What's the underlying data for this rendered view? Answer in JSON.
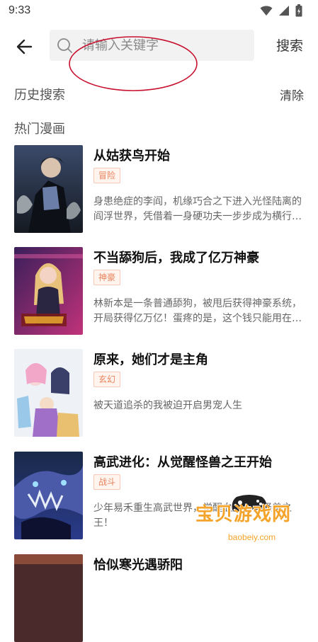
{
  "status_bar": {
    "time": "9:33"
  },
  "search": {
    "placeholder": "请输入关键字",
    "button_label": "搜索"
  },
  "history": {
    "title": "历史搜索",
    "clear_label": "清除"
  },
  "hot": {
    "title": "热门漫画",
    "items": [
      {
        "title": "从姑获鸟开始",
        "tag": "冒险",
        "desc": "身患绝症的李阎，机缘巧合之下进入光怪陆离的阎浮世界，凭借着一身硬功夫一步步成为横行天下的武者"
      },
      {
        "title": "不当舔狗后，我成了亿万神豪",
        "tag": "神豪",
        "desc": "林新本是一条普通舔狗，被甩后获得神豪系统，开局获得亿万亿！蛋疼的是，这个钱只能用在别的女人身上"
      },
      {
        "title": "原来，她们才是主角",
        "tag": "玄幻",
        "desc": "被天道追杀的我被迫开启男宠人生"
      },
      {
        "title": "高武进化：从觉醒怪兽之王开始",
        "tag": "战斗",
        "desc": "少年易禾重生高武世界，觉醒血脉模板怪兽之王！"
      },
      {
        "title": "恰似寒光遇骄阳",
        "tag": "",
        "desc": ""
      }
    ]
  },
  "watermark": {
    "text": "宝贝游戏网",
    "url": "baobeiy.com"
  }
}
